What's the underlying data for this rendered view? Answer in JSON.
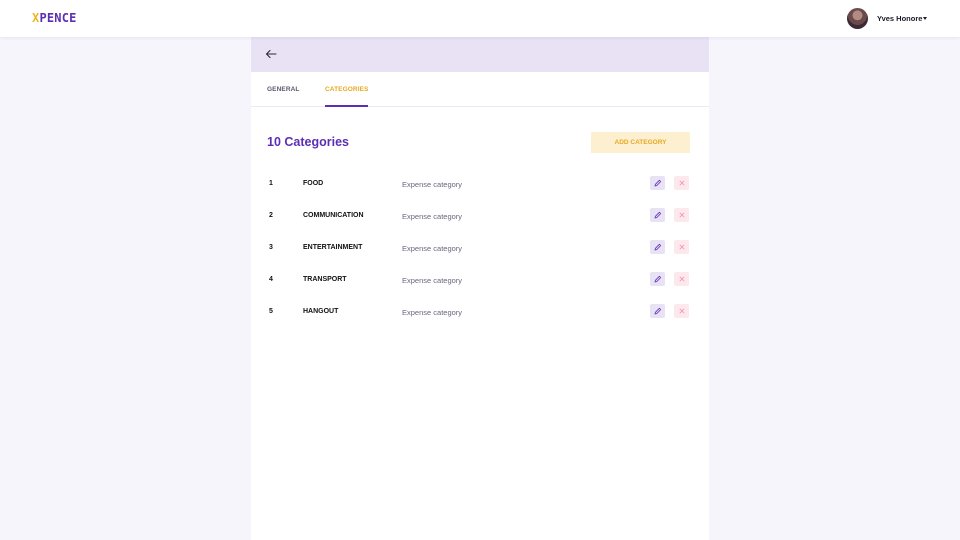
{
  "brand": {
    "logo_first": "X",
    "logo_rest": "PENCE"
  },
  "user": {
    "name": "Yves Honore"
  },
  "tabs": [
    {
      "label": "GENERAL",
      "active": false
    },
    {
      "label": "CATEGORIES",
      "active": true
    }
  ],
  "main": {
    "count_title": "10 Categories",
    "add_button": "ADD CATEGORY"
  },
  "categories": [
    {
      "num": "1",
      "name": "FOOD",
      "desc": "Expense category"
    },
    {
      "num": "2",
      "name": "COMMUNICATION",
      "desc": "Expense category"
    },
    {
      "num": "3",
      "name": "ENTERTAINMENT",
      "desc": "Expense category"
    },
    {
      "num": "4",
      "name": "TRANSPORT",
      "desc": "Expense category"
    },
    {
      "num": "5",
      "name": "HANGOUT",
      "desc": "Expense category"
    }
  ],
  "colors": {
    "brand_purple": "#5b2fb3",
    "accent_yellow": "#e8a920",
    "header_lavender": "#e9e2f5",
    "delete_pink": "#fde8ee"
  },
  "icons": {
    "back": "arrow-left-icon",
    "edit": "pencil-icon",
    "delete": "close-icon",
    "dropdown": "caret-down-icon"
  }
}
